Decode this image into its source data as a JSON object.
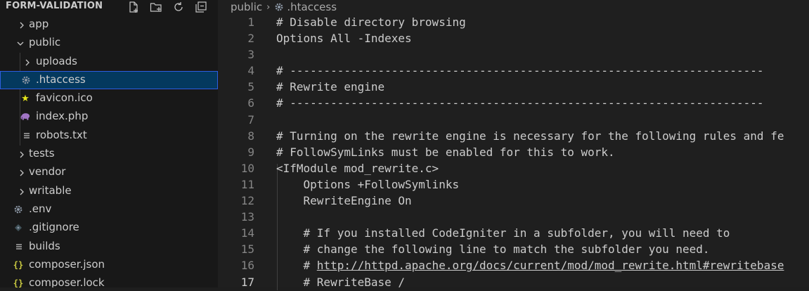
{
  "explorer": {
    "title": "FORM-VALIDATION",
    "actions": [
      "new-file-icon",
      "new-folder-icon",
      "refresh-icon",
      "collapse-all-icon"
    ],
    "items": [
      {
        "label": "app",
        "type": "folder",
        "expanded": false,
        "depth": 0
      },
      {
        "label": "public",
        "type": "folder",
        "expanded": true,
        "depth": 0
      },
      {
        "label": "uploads",
        "type": "folder",
        "expanded": false,
        "depth": 1
      },
      {
        "label": ".htaccess",
        "type": "file",
        "icon": "gear-icon",
        "depth": 1,
        "selected": true
      },
      {
        "label": "favicon.ico",
        "type": "file",
        "icon": "star-icon",
        "depth": 1
      },
      {
        "label": "index.php",
        "type": "file",
        "icon": "php-elephant-icon",
        "depth": 1
      },
      {
        "label": "robots.txt",
        "type": "file",
        "icon": "text-lines-icon",
        "depth": 1
      },
      {
        "label": "tests",
        "type": "folder",
        "expanded": false,
        "depth": 0
      },
      {
        "label": "vendor",
        "type": "folder",
        "expanded": false,
        "depth": 0
      },
      {
        "label": "writable",
        "type": "folder",
        "expanded": false,
        "depth": 0
      },
      {
        "label": ".env",
        "type": "file",
        "icon": "gear-icon",
        "depth": 0
      },
      {
        "label": ".gitignore",
        "type": "file",
        "icon": "git-diamond-icon",
        "depth": 0
      },
      {
        "label": "builds",
        "type": "file",
        "icon": "text-lines-icon",
        "depth": 0
      },
      {
        "label": "composer.json",
        "type": "file",
        "icon": "json-braces-icon",
        "depth": 0
      },
      {
        "label": "composer.lock",
        "type": "file",
        "icon": "json-braces-icon",
        "depth": 0
      }
    ]
  },
  "editor": {
    "breadcrumb": {
      "folder": "public",
      "file": ".htaccess"
    },
    "active_line": 17,
    "lines": [
      {
        "n": "1",
        "text": "# Disable directory browsing"
      },
      {
        "n": "2",
        "text": "Options All -Indexes"
      },
      {
        "n": "3",
        "text": ""
      },
      {
        "n": "4",
        "text": "# ----------------------------------------------------------------------"
      },
      {
        "n": "5",
        "text": "# Rewrite engine"
      },
      {
        "n": "6",
        "text": "# ----------------------------------------------------------------------"
      },
      {
        "n": "7",
        "text": ""
      },
      {
        "n": "8",
        "text": "# Turning on the rewrite engine is necessary for the following rules and fe"
      },
      {
        "n": "9",
        "text": "# FollowSymLinks must be enabled for this to work."
      },
      {
        "n": "10",
        "text": "<IfModule mod_rewrite.c>"
      },
      {
        "n": "11",
        "text": "    Options +FollowSymlinks"
      },
      {
        "n": "12",
        "text": "    RewriteEngine On"
      },
      {
        "n": "13",
        "text": ""
      },
      {
        "n": "14",
        "text": "    # If you installed CodeIgniter in a subfolder, you will need to"
      },
      {
        "n": "15",
        "text": "    # change the following line to match the subfolder you need."
      },
      {
        "n": "16",
        "prefix": "    # ",
        "link": "http://httpd.apache.org/docs/current/mod/mod_rewrite.html#rewritebase"
      },
      {
        "n": "17",
        "text": "    # RewriteBase /"
      }
    ]
  },
  "colors": {
    "sidebar_bg": "#181818",
    "editor_bg": "#1f1f1f",
    "selection_bg": "#04395e",
    "selection_border": "#2d5ee0",
    "text": "#cccccc",
    "line_number": "#858585"
  }
}
